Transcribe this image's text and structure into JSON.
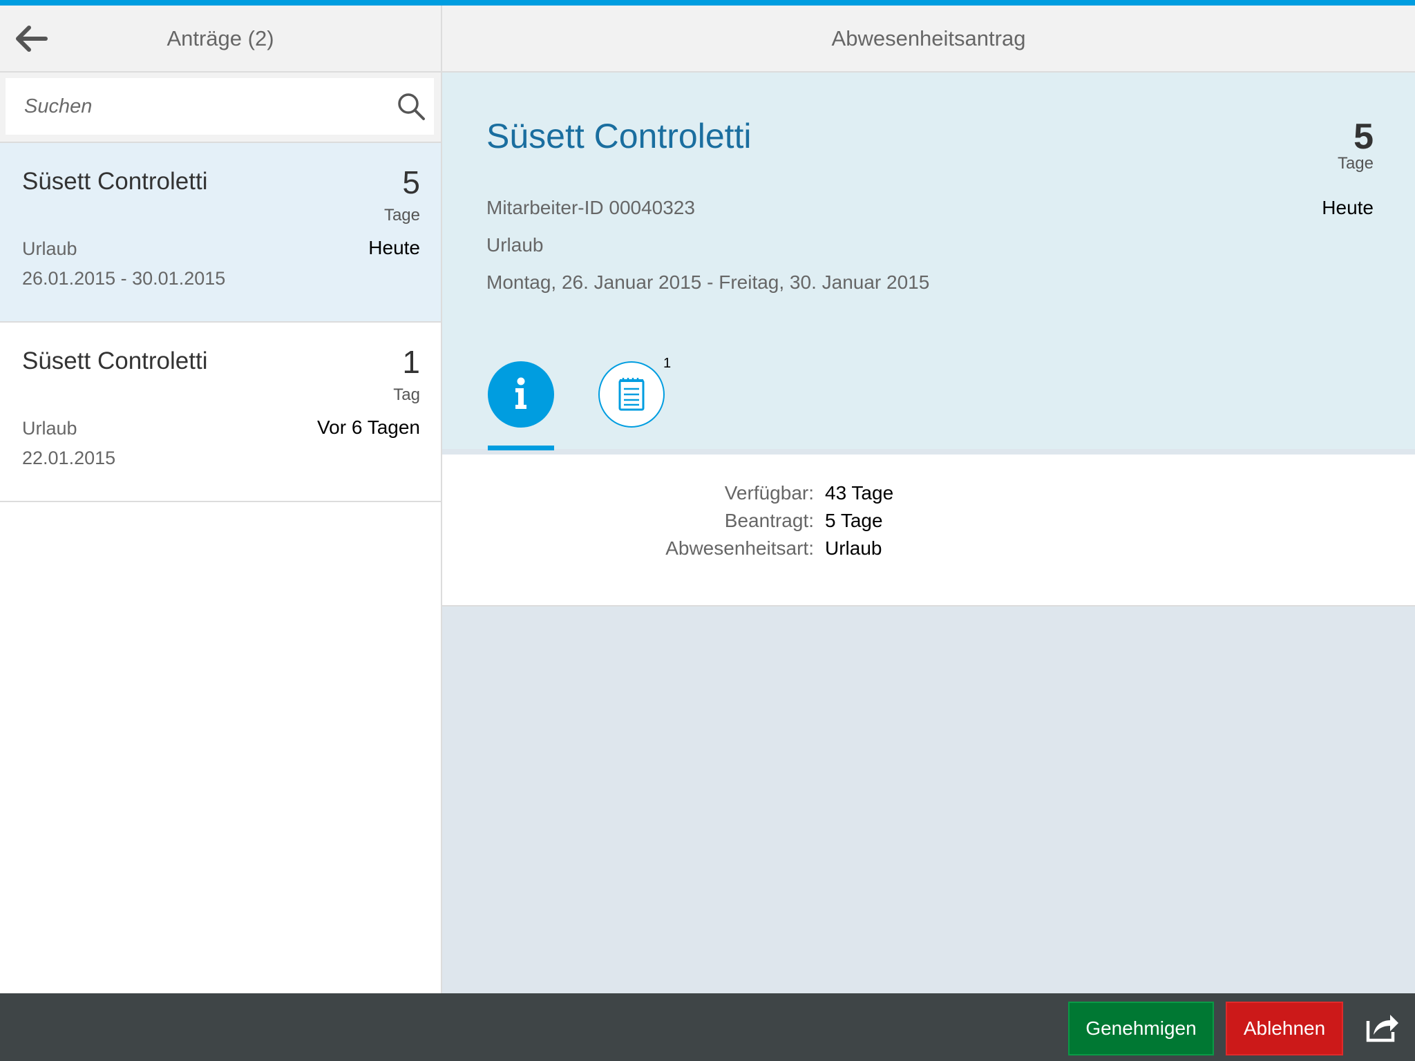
{
  "master": {
    "title": "Anträge (2)",
    "search_placeholder": "Suchen",
    "items": [
      {
        "name": "Süsett Controletti",
        "number": "5",
        "unit": "Tage",
        "type": "Urlaub",
        "when": "Heute",
        "dates": "26.01.2015 - 30.01.2015",
        "selected": true
      },
      {
        "name": "Süsett Controletti",
        "number": "1",
        "unit": "Tag",
        "type": "Urlaub",
        "when": "Vor 6 Tagen",
        "dates": "22.01.2015",
        "selected": false
      }
    ]
  },
  "detail": {
    "title": "Abwesenheitsantrag",
    "name": "Süsett Controletti",
    "number": "5",
    "unit": "Tage",
    "employee_id": "Mitarbeiter-ID 00040323",
    "type": "Urlaub",
    "period": "Montag, 26. Januar 2015 - Freitag, 30. Januar 2015",
    "status": "Heute",
    "tabs": [
      {
        "icon": "info-icon",
        "selected": true
      },
      {
        "icon": "notes-icon",
        "count": "1",
        "selected": false
      }
    ],
    "form": [
      {
        "label": "Verfügbar:",
        "value": "43 Tage"
      },
      {
        "label": "Beantragt:",
        "value": "5 Tage"
      },
      {
        "label": "Abwesenheitsart:",
        "value": "Urlaub"
      }
    ]
  },
  "footer": {
    "approve_label": "Genehmigen",
    "reject_label": "Ablehnen",
    "share_icon": "share-icon"
  },
  "colors": {
    "accent": "#009de0",
    "approve": "#007833",
    "reject": "#cc1919",
    "footer": "#3f4547",
    "title_blue": "#1a6e9f"
  }
}
